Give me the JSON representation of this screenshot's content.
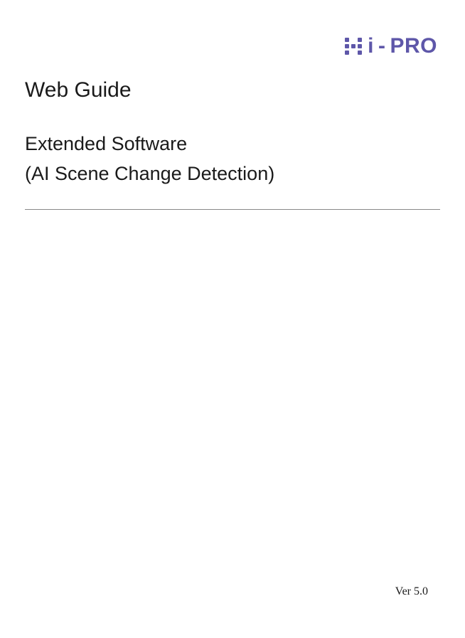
{
  "brand": {
    "name": "i-PRO"
  },
  "title": "Web Guide",
  "subtitle_line1": "Extended Software",
  "subtitle_line2": "(AI Scene Change Detection)",
  "version": "Ver 5.0"
}
